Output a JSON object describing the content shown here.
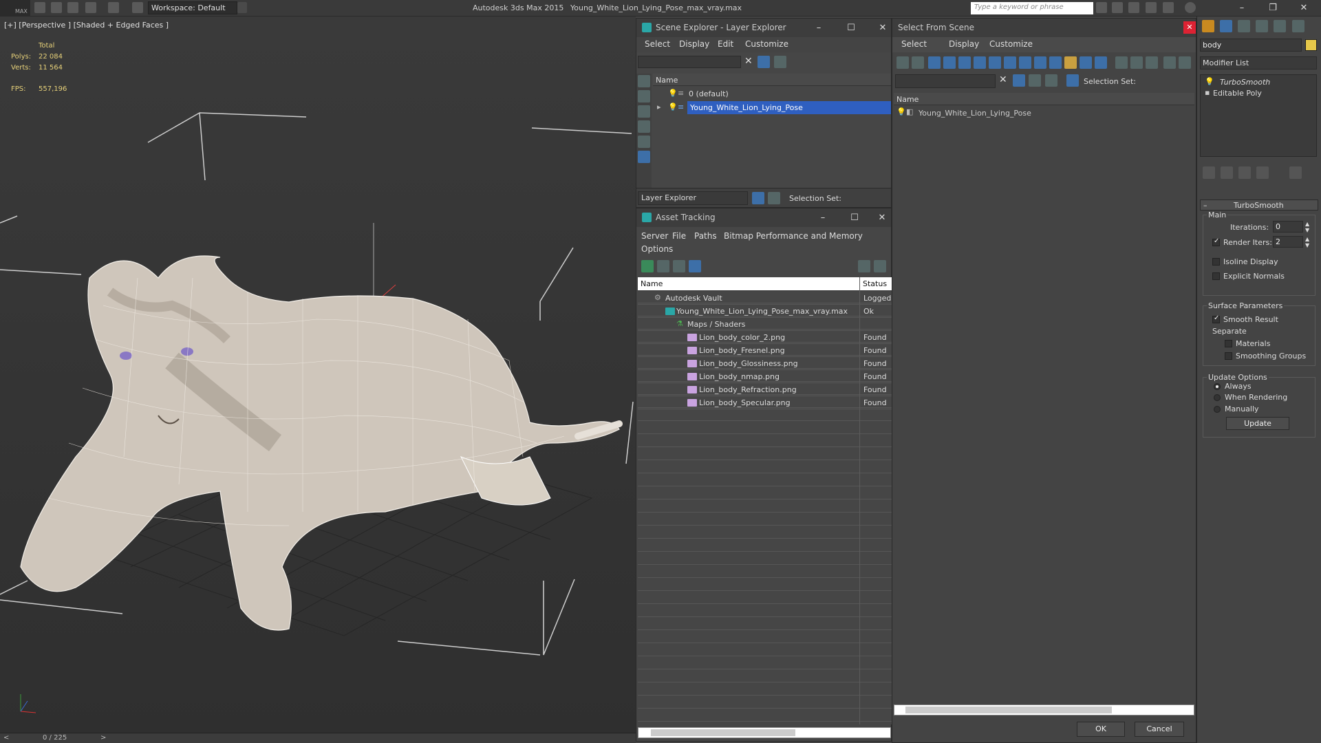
{
  "titlebar": {
    "app_title": "Autodesk 3ds Max  2015",
    "file_title": "Young_White_Lion_Lying_Pose_max_vray.max",
    "workspace": "Workspace: Default",
    "search_placeholder": "Type a keyword or phrase",
    "logo_text": "MAX"
  },
  "viewport": {
    "label": "[+] [Perspective ] [Shaded + Edged Faces ]",
    "stats": {
      "total_label": "Total",
      "polys_label": "Polys:",
      "polys_value": "22 084",
      "verts_label": "Verts:",
      "verts_value": "11 564",
      "fps_label": "FPS:",
      "fps_value": "557,196"
    },
    "timeline": {
      "frame": "0 / 225",
      "prev": "<",
      "next": ">"
    }
  },
  "scene_explorer": {
    "title": "Scene Explorer - Layer Explorer",
    "menu": [
      "Select",
      "Display",
      "Edit",
      "Customize"
    ],
    "column_name": "Name",
    "rows": [
      "0 (default)",
      "Young_White_Lion_Lying_Pose"
    ],
    "footer_dropdown": "Layer Explorer",
    "selection_set": "Selection Set:"
  },
  "asset_tracking": {
    "title": "Asset Tracking",
    "menu": [
      "Server",
      "File",
      "Paths",
      "Bitmap Performance and Memory",
      "Options"
    ],
    "columns": [
      "Name",
      "Status"
    ],
    "rows": [
      {
        "name": "Autodesk Vault",
        "status": "Logged"
      },
      {
        "name": "Young_White_Lion_Lying_Pose_max_vray.max",
        "status": "Ok"
      },
      {
        "name": "Maps / Shaders",
        "status": ""
      },
      {
        "name": "Lion_body_color_2.png",
        "status": "Found"
      },
      {
        "name": "Lion_body_Fresnel.png",
        "status": "Found"
      },
      {
        "name": "Lion_body_Glossiness.png",
        "status": "Found"
      },
      {
        "name": "Lion_body_nmap.png",
        "status": "Found"
      },
      {
        "name": "Lion_body_Refraction.png",
        "status": "Found"
      },
      {
        "name": "Lion_body_Specular.png",
        "status": "Found"
      }
    ]
  },
  "select_from_scene": {
    "title": "Select From Scene",
    "menu": [
      "Select",
      "Display",
      "Customize"
    ],
    "selection_set": "Selection Set:",
    "column_name": "Name",
    "rows": [
      "Young_White_Lion_Lying_Pose"
    ],
    "ok": "OK",
    "cancel": "Cancel"
  },
  "command_panel": {
    "object_name": "body",
    "modifier_list": "Modifier List",
    "stack": [
      "TurboSmooth",
      "Editable Poly"
    ],
    "rollout_title": "TurboSmooth",
    "main_label": "Main",
    "iterations_label": "Iterations:",
    "iterations_value": "0",
    "render_iters_label": "Render Iters:",
    "render_iters_value": "2",
    "isoline": "Isoline Display",
    "explicit_normals": "Explicit Normals",
    "surface_params": "Surface Parameters",
    "smooth_result": "Smooth Result",
    "separate": "Separate",
    "materials": "Materials",
    "smoothing_groups": "Smoothing Groups",
    "update_options": "Update Options",
    "always": "Always",
    "when_rendering": "When Rendering",
    "manually": "Manually",
    "update_button": "Update"
  }
}
